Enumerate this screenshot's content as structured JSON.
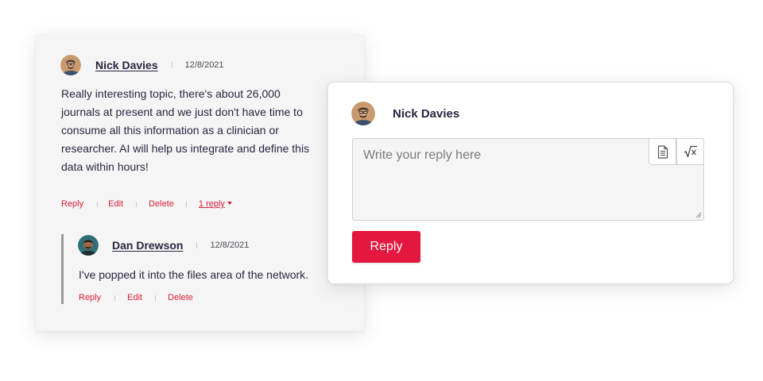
{
  "thread": {
    "comment": {
      "author": "Nick Davies",
      "date": "12/8/2021",
      "body": "Really interesting topic, there's about 26,000 journals at present and we just don't have time to consume all this information as a clinician or researcher. AI will help us integrate and define this data within hours!",
      "actions": {
        "reply": "Reply",
        "edit": "Edit",
        "delete": "Delete",
        "replies": "1 reply"
      }
    },
    "reply": {
      "author": "Dan Drewson",
      "date": "12/8/2021",
      "body": "I've popped it into the files area of the network.",
      "actions": {
        "reply": "Reply",
        "edit": "Edit",
        "delete": "Delete"
      }
    }
  },
  "composer": {
    "user_name": "Nick Davies",
    "placeholder": "Write your reply here",
    "tools": [
      "document-icon",
      "square-root-icon"
    ],
    "submit_label": "Reply"
  },
  "colors": {
    "accent": "#e3173f",
    "link": "#d8213a",
    "text": "#2b2540",
    "card_bg": "#f5f5f5"
  }
}
